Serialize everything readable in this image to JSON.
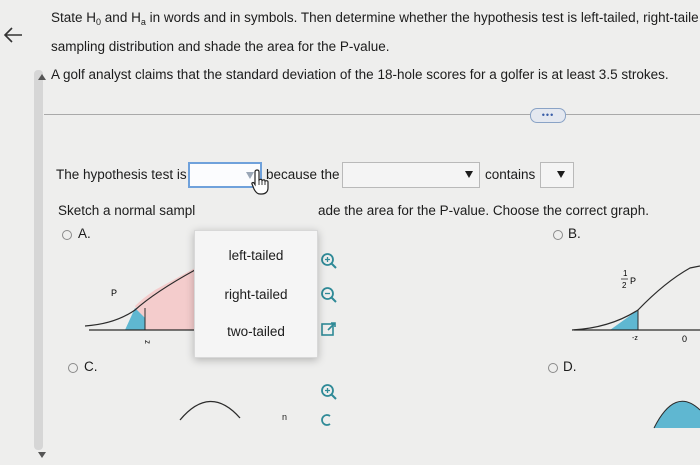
{
  "question": {
    "instruction_line1_parts": [
      "State H",
      "0",
      " and H",
      "a",
      " in words and in symbols. Then determine whether the hypothesis test is left-tailed, right-taile"
    ],
    "instruction_line2": "sampling distribution and shade the area for the P-value.",
    "claim": "A golf analyst claims that the standard deviation of the 18-hole scores for a golfer is at least 3.5 strokes."
  },
  "more_button": "•••",
  "sentence": {
    "prefix": "The hypothesis test is",
    "middle": "because the",
    "suffix": "contains"
  },
  "sketch_text_left": "Sketch a normal sampl",
  "sketch_text_right": "ade the area for the P-value. Choose the correct graph.",
  "dropdown": {
    "options": [
      "left-tailed",
      "right-tailed",
      "two-tailed"
    ]
  },
  "choices": {
    "a": "A.",
    "b": "B.",
    "c": "C.",
    "d": "D."
  },
  "graph_labels": {
    "a_p": "P",
    "a_z": "z",
    "b_frac_num": "1",
    "b_frac_den": "2",
    "b_p": "P",
    "b_z": "-z",
    "b_zero": "0",
    "c_z": "n"
  },
  "colors": {
    "shade_blue": "#5fb7d1",
    "shade_pink": "#f4cccc",
    "select_border": "#6fa1db",
    "zoom_icon": "#2f8a97"
  }
}
